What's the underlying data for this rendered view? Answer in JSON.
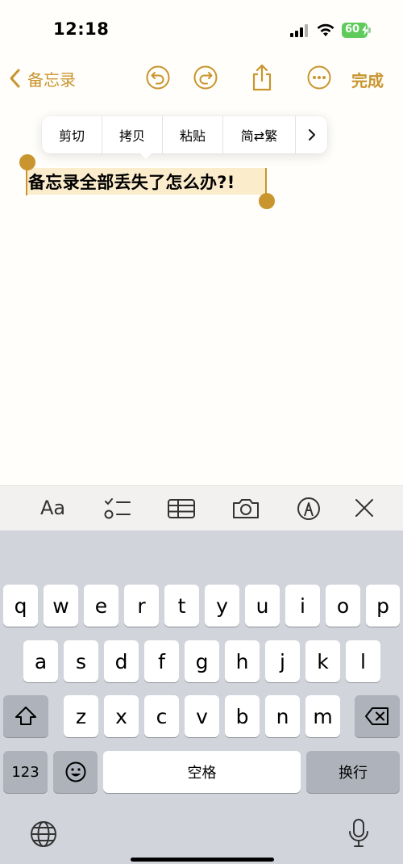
{
  "status": {
    "time": "12:18",
    "battery": "60"
  },
  "nav": {
    "back_label": "备忘录",
    "done_label": "完成"
  },
  "edit_menu": {
    "items": [
      "剪切",
      "拷贝",
      "粘贴",
      "简⇄繁"
    ]
  },
  "note": {
    "selected_text": "备忘录全部丢失了怎么办?!"
  },
  "toolbar": {
    "format_label": "Aa"
  },
  "keyboard": {
    "row1": [
      "q",
      "w",
      "e",
      "r",
      "t",
      "y",
      "u",
      "i",
      "o",
      "p"
    ],
    "row2": [
      "a",
      "s",
      "d",
      "f",
      "g",
      "h",
      "j",
      "k",
      "l"
    ],
    "row3": [
      "z",
      "x",
      "c",
      "v",
      "b",
      "n",
      "m"
    ],
    "numbers_key": "123",
    "space_label": "空格",
    "return_label": "换行"
  },
  "colors": {
    "accent": "#c8952e",
    "selection": "#fbeccc",
    "battery": "#5ecb5a"
  }
}
